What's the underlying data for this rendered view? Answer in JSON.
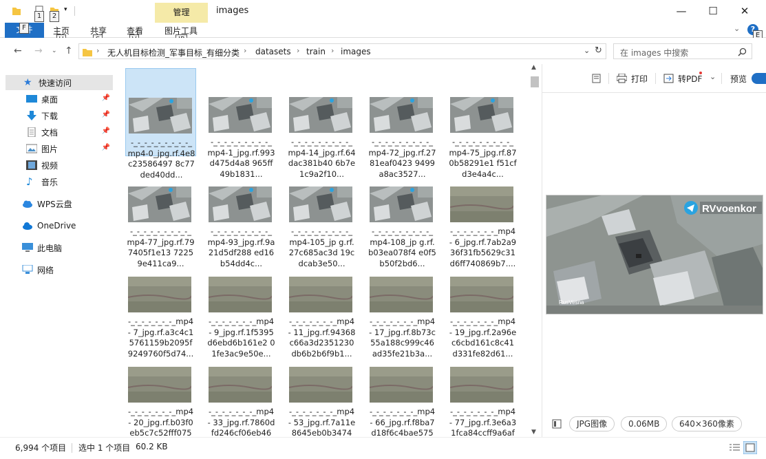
{
  "window": {
    "title": "images",
    "context_tab": "管理",
    "minimize": "—",
    "maximize": "☐",
    "close": "✕"
  },
  "keytips": {
    "qa1": "1",
    "qa2": "2",
    "file": "F",
    "home": "H",
    "share": "S",
    "view": "V",
    "picture_tools": "JP",
    "help": "E"
  },
  "ribbon": {
    "file": "文件",
    "home": "主页",
    "share": "共享",
    "view": "查看",
    "picture_tools": "图片工具"
  },
  "address": {
    "crumbs": [
      "无人机目标检测_军事目标_有细分类",
      "datasets",
      "train",
      "images"
    ]
  },
  "search": {
    "placeholder": "在 images 中搜索"
  },
  "nav": {
    "items": [
      {
        "label": "快速访问",
        "icon": "star-icon",
        "pinned": false
      },
      {
        "label": "桌面",
        "icon": "desktop-icon",
        "pinned": true
      },
      {
        "label": "下载",
        "icon": "download-icon",
        "pinned": true
      },
      {
        "label": "文档",
        "icon": "document-icon",
        "pinned": true
      },
      {
        "label": "图片",
        "icon": "picture-icon",
        "pinned": true
      },
      {
        "label": "视频",
        "icon": "video-icon",
        "pinned": false
      },
      {
        "label": "音乐",
        "icon": "music-icon",
        "pinned": false
      },
      {
        "label": "WPS云盘",
        "icon": "cloud-icon",
        "pinned": false
      },
      {
        "label": "OneDrive",
        "icon": "onedrive-icon",
        "pinned": false
      },
      {
        "label": "此电脑",
        "icon": "computer-icon",
        "pinned": false
      },
      {
        "label": "网络",
        "icon": "network-icon",
        "pinned": false
      }
    ]
  },
  "files": [
    {
      "name": "-_-_-_-_-_-_-_-_-_mp4-0_jpg.rf.4e8c23586497 8c77ded40dd...",
      "thumb": "city",
      "selected": true
    },
    {
      "name": "-_-_-_-_-_-_-_-_-_mp4-1_jpg.rf.993d475d4a8 965ff49b1831...",
      "thumb": "city"
    },
    {
      "name": "-_-_-_-_-_-_-_-_-_mp4-14_jpg.rf.64dac381b40 6b7e1c9a2f10...",
      "thumb": "city"
    },
    {
      "name": "-_-_-_-_-_-_-_-_-_mp4-72_jpg.rf.2781eaf0423 9499a8ac3527...",
      "thumb": "city"
    },
    {
      "name": "-_-_-_-_-_-_-_-_-_mp4-75_jpg.rf.870b58291e1 f51cfd3e4a4c...",
      "thumb": "city"
    },
    {
      "name": "-_-_-_-_-_-_-_-_-_mp4-77_jpg.rf.797405f1e13 72259e411ca9...",
      "thumb": "city"
    },
    {
      "name": "-_-_-_-_-_-_-_-_-_mp4-93_jpg.rf.9a21d5df288 ed16b54dd4c...",
      "thumb": "city"
    },
    {
      "name": "-_-_-_-_-_-_-_-_-_mp4-105_jp g.rf.27c685ac3d 19cdcab3e50...",
      "thumb": "city"
    },
    {
      "name": "-_-_-_-_-_-_-_-_-_mp4-108_jp g.rf.b03ea078f4 e0f5b50f2bd6...",
      "thumb": "city"
    },
    {
      "name": "-_-_-_-_-_-_-_mp4- 6_jpg.rf.7ab2a9 36f31fb5629c31 d6ff740869b7....",
      "thumb": "field"
    },
    {
      "name": "-_-_-_-_-_-_-_mp4- 7_jpg.rf.a3c4c1 5761159b2095f 9249760f5d74...",
      "thumb": "field"
    },
    {
      "name": "-_-_-_-_-_-_-_mp4- 9_jpg.rf.1f5395 d6ebd6b161e2 01fe3ac9e50e...",
      "thumb": "field"
    },
    {
      "name": "-_-_-_-_-_-_-_mp4- 11_jpg.rf.94368 c66a3d2351230 db6b2b6f9b1...",
      "thumb": "field"
    },
    {
      "name": "-_-_-_-_-_-_-_mp4- 17_jpg.rf.8b73c 55a188c999c46 ad35fe21b3a...",
      "thumb": "field"
    },
    {
      "name": "-_-_-_-_-_-_-_mp4- 19_jpg.rf.2a96e c6cbd161c8c41 d331fe82d61...",
      "thumb": "field"
    },
    {
      "name": "-_-_-_-_-_-_-_mp4- 20_jpg.rf.b03f0 eb5c7c52fff075",
      "thumb": "field"
    },
    {
      "name": "-_-_-_-_-_-_-_mp4- 33_jpg.rf.7860d fd246cf06eb46",
      "thumb": "field"
    },
    {
      "name": "-_-_-_-_-_-_-_mp4- 53_jpg.rf.7a11e 8645eb0b3474",
      "thumb": "field"
    },
    {
      "name": "-_-_-_-_-_-_-_mp4- 66_jpg.rf.f8ba7 d18f6c4bae575",
      "thumb": "field"
    },
    {
      "name": "-_-_-_-_-_-_-_mp4- 77_jpg.rf.3e6a3 1fca84ccff9a6af",
      "thumb": "field"
    }
  ],
  "preview": {
    "print": "打印",
    "to_pdf": "转PDF",
    "preview_label": "预览",
    "watermark": "RVvoenkor",
    "watermark_small": "RusVesna",
    "type": "JPG图像",
    "size": "0.06MB",
    "dimensions": "640×360像素"
  },
  "status": {
    "count": "6,994 个项目",
    "selected": "选中 1 个项目",
    "filesize": "60.2 KB"
  },
  "colors": {
    "accent": "#1f6fc5",
    "selection": "#cce4f7",
    "context_tab": "#f5eaa8"
  }
}
